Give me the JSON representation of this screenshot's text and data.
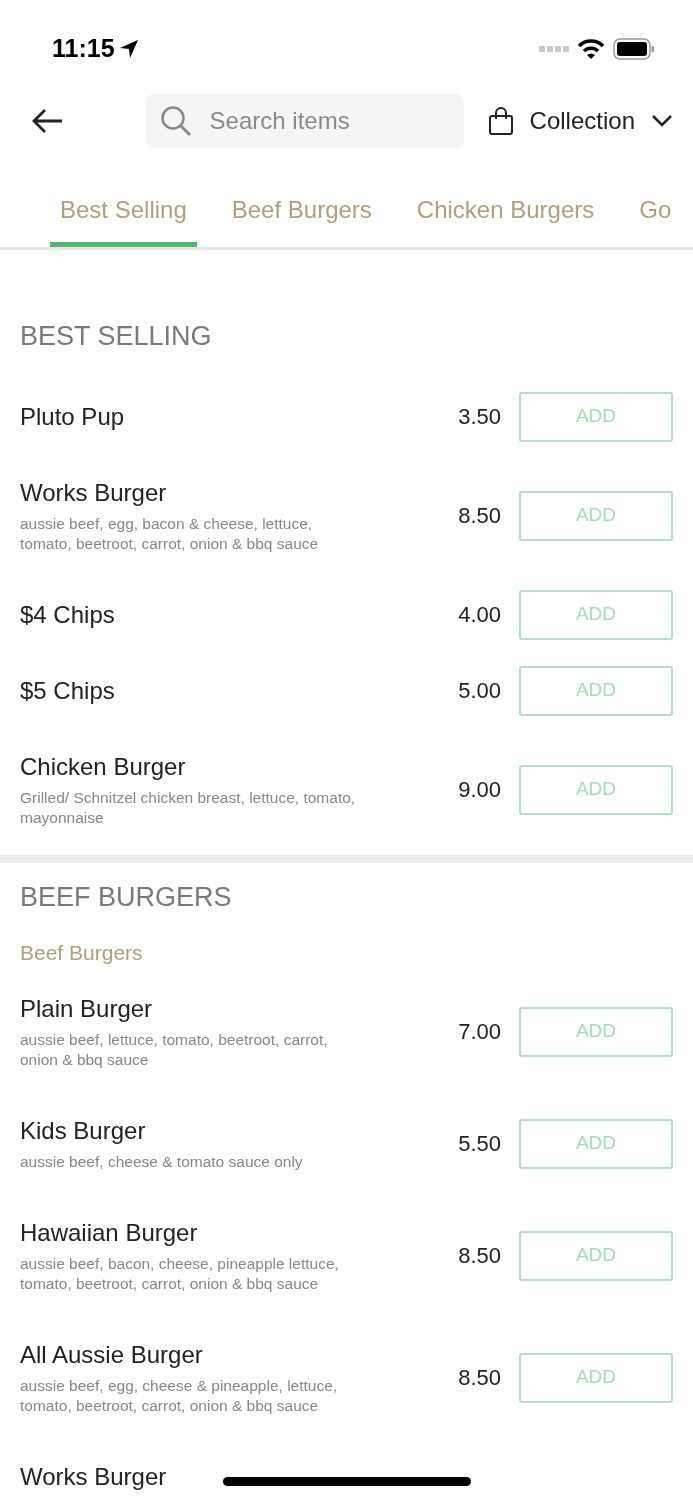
{
  "status_bar": {
    "time": "11:15"
  },
  "header": {
    "search": {
      "placeholder": "Search items"
    },
    "order_mode": "Collection"
  },
  "tabs": [
    {
      "label": "Best Selling",
      "selected": true
    },
    {
      "label": "Beef Burgers",
      "selected": false
    },
    {
      "label": "Chicken Burgers",
      "selected": false
    },
    {
      "label": "Go",
      "selected": false
    }
  ],
  "sections": [
    {
      "title": "BEST SELLING",
      "items": [
        {
          "name": "Pluto Pup",
          "price": "3.50",
          "button": "ADD"
        },
        {
          "name": "Works Burger",
          "description": "aussie beef, egg, bacon & cheese, lettuce, tomato, beetroot, carrot, onion & bbq sauce",
          "price": "8.50",
          "button": "ADD"
        },
        {
          "name": "$4 Chips",
          "price": "4.00",
          "button": "ADD"
        },
        {
          "name": "$5 Chips",
          "price": "5.00",
          "button": "ADD"
        },
        {
          "name": "Chicken Burger",
          "description": "Grilled/ Schnitzel chicken breast, lettuce, tomato, mayonnaise",
          "price": "9.00",
          "button": "ADD"
        }
      ]
    },
    {
      "title": "BEEF BURGERS",
      "subtitle": "Beef Burgers",
      "items": [
        {
          "name": "Plain Burger",
          "description": "aussie beef, lettuce, tomato, beetroot, carrot, onion & bbq sauce",
          "price": "7.00",
          "button": "ADD"
        },
        {
          "name": "Kids Burger",
          "description": "aussie beef, cheese & tomato sauce only",
          "price": "5.50",
          "button": "ADD"
        },
        {
          "name": "Hawaiian Burger",
          "description": "aussie beef, bacon, cheese, pineapple lettuce, tomato, beetroot, carrot, onion & bbq sauce",
          "price": "8.50",
          "button": "ADD"
        },
        {
          "name": "All Aussie Burger",
          "description": "aussie beef, egg, cheese & pineapple, lettuce, tomato, beetroot, carrot, onion & bbq sauce",
          "price": "8.50",
          "button": "ADD"
        },
        {
          "name": "Works Burger"
        }
      ]
    }
  ]
}
